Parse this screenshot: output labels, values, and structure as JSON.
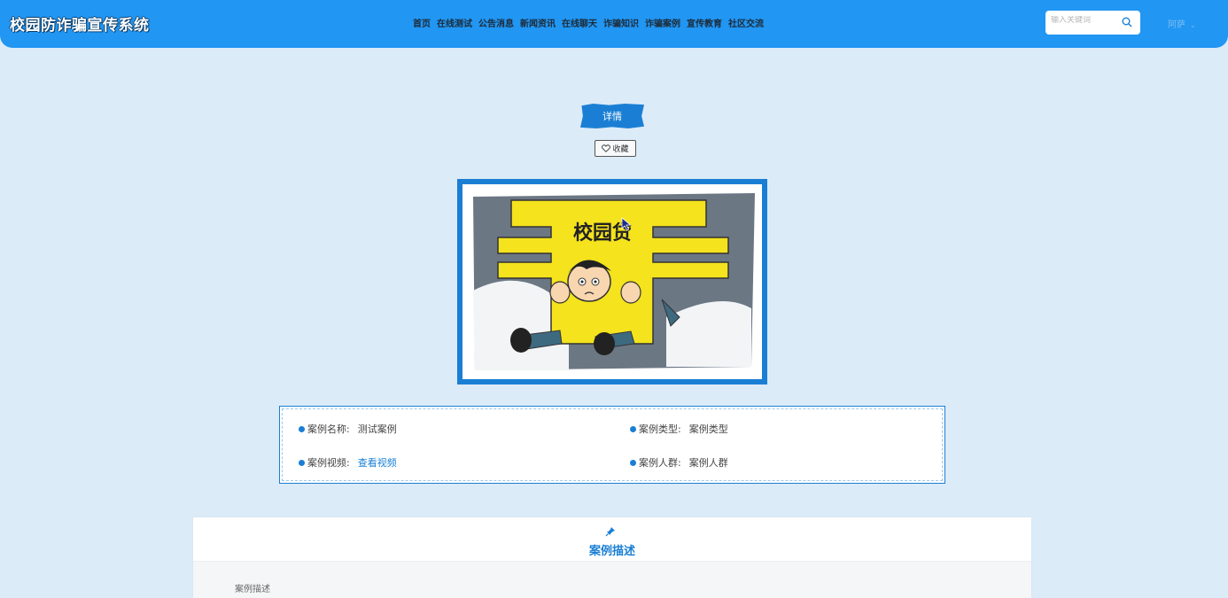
{
  "header": {
    "brand": "校园防诈骗宣传系统",
    "nav": [
      "首页",
      "在线测试",
      "公告消息",
      "新闻资讯",
      "在线聊天",
      "诈骗知识",
      "诈骗案例",
      "宣传教育",
      "社区交流"
    ],
    "search_placeholder": "输入关键词",
    "user_name": "阿萨"
  },
  "detail": {
    "banner": "详情",
    "favorite_label": "收藏"
  },
  "image": {
    "caption": "校园贷"
  },
  "info": {
    "case_name_label": "案例名称:",
    "case_name": "测试案例",
    "case_type_label": "案例类型:",
    "case_type": "案例类型",
    "case_video_label": "案例视频:",
    "case_video_link": "查看视频",
    "case_group_label": "案例人群:",
    "case_group": "案例人群"
  },
  "description": {
    "title": "案例描述",
    "body": "案例描述"
  },
  "colors": {
    "header_bg": "#2196f3",
    "accent": "#1a7fd4",
    "page_bg": "#dcebf8"
  }
}
